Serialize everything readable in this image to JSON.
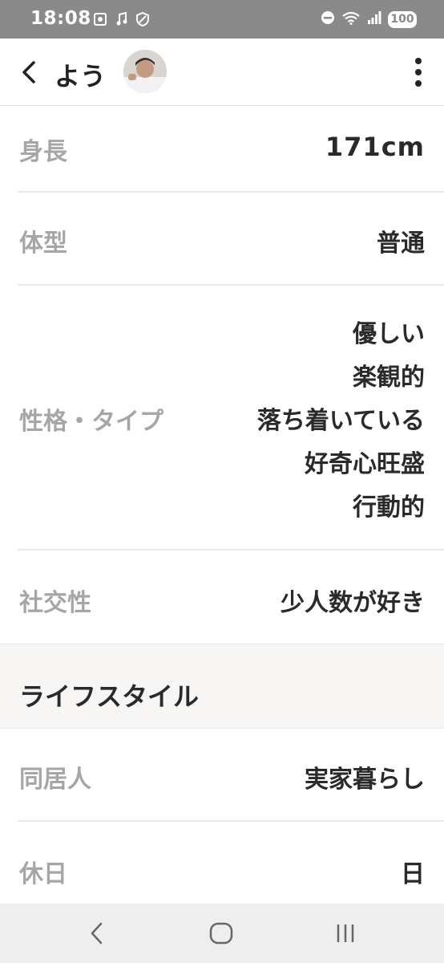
{
  "status_bar": {
    "time": "18:08",
    "battery": "100",
    "icons": [
      "screenshot-icon",
      "music-icon",
      "shield-icon",
      "dnd-icon",
      "wifi-icon",
      "signal-icon",
      "battery-icon"
    ]
  },
  "header": {
    "name": "よう",
    "back_icon": "chevron-left-icon",
    "more_icon": "more-vertical-icon"
  },
  "profile": {
    "height": {
      "label": "身長",
      "value": "171cm"
    },
    "body_type": {
      "label": "体型",
      "value": "普通"
    },
    "personality": {
      "label": "性格・タイプ",
      "values": [
        "優しい",
        "楽観的",
        "落ち着いている",
        "好奇心旺盛",
        "行動的"
      ]
    },
    "sociability": {
      "label": "社交性",
      "value": "少人数が好き"
    }
  },
  "lifestyle": {
    "section_title": "ライフスタイル",
    "housemate": {
      "label": "同居人",
      "value": "実家暮らし"
    },
    "holiday": {
      "label": "休日",
      "value": "日"
    }
  },
  "nav_bar": {
    "icons": [
      "back-nav-icon",
      "home-nav-icon",
      "recents-nav-icon"
    ]
  },
  "colors": {
    "status_bar": "#8a8a8a",
    "label": "#a6a6a6",
    "value": "#2a2a2a",
    "section_bg": "#f7f6f4",
    "nav_bg": "#eeeeee"
  }
}
